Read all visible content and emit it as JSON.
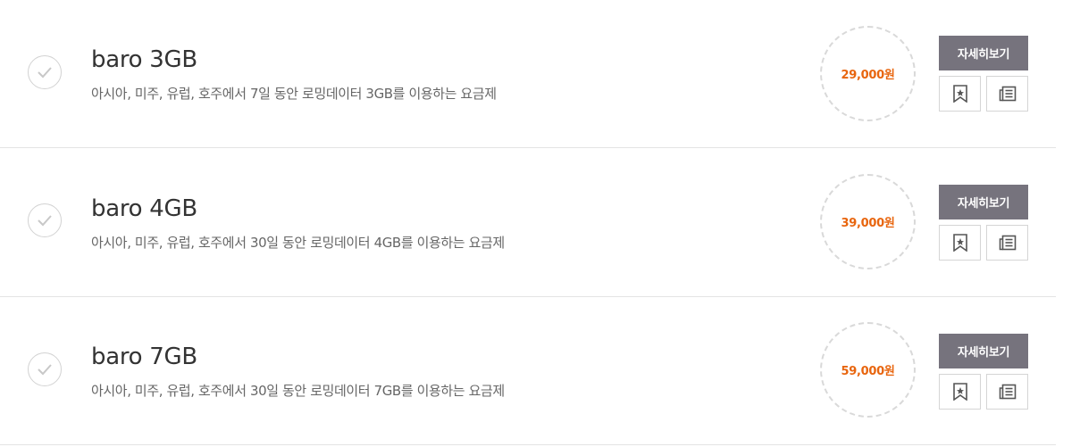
{
  "plans": [
    {
      "name": "baro 3GB",
      "description": "아시아, 미주, 유럽, 호주에서 7일 동안 로밍데이터 3GB를 이용하는 요금제",
      "price": "29,000원",
      "detail_label": "자세히보기",
      "check_icon": "checkmark-icon",
      "bookmark_icon": "bookmark-star-icon",
      "compare_icon": "document-list-icon"
    },
    {
      "name": "baro 4GB",
      "description": "아시아, 미주, 유럽, 호주에서 30일 동안 로밍데이터 4GB를 이용하는 요금제",
      "price": "39,000원",
      "detail_label": "자세히보기",
      "check_icon": "checkmark-icon",
      "bookmark_icon": "bookmark-star-icon",
      "compare_icon": "document-list-icon"
    },
    {
      "name": "baro 7GB",
      "description": "아시아, 미주, 유럽, 호주에서 30일 동안 로밍데이터 7GB를 이용하는 요금제",
      "price": "59,000원",
      "detail_label": "자세히보기",
      "check_icon": "checkmark-icon",
      "bookmark_icon": "bookmark-star-icon",
      "compare_icon": "document-list-icon"
    }
  ],
  "colors": {
    "price": "#e8650e",
    "detail_button_bg": "#76737d",
    "divider": "#e3e3e3",
    "price_circle_border": "#d9d9d9"
  }
}
